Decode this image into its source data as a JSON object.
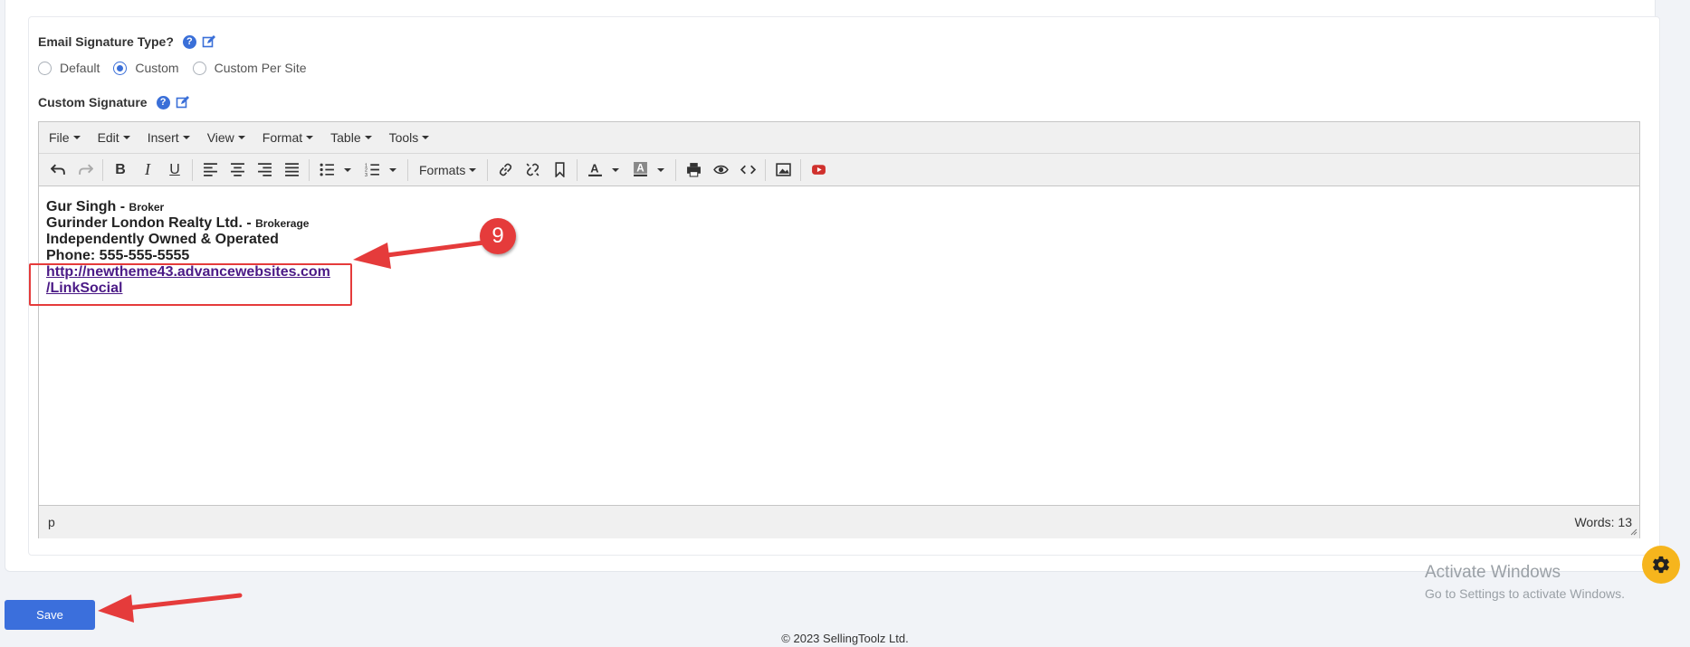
{
  "signature_type": {
    "label": "Email Signature Type?",
    "options": [
      {
        "label": "Default",
        "checked": false
      },
      {
        "label": "Custom",
        "checked": true
      },
      {
        "label": "Custom Per Site",
        "checked": false
      }
    ]
  },
  "custom_signature": {
    "label": "Custom Signature"
  },
  "editor": {
    "menus": [
      "File",
      "Edit",
      "Insert",
      "View",
      "Format",
      "Table",
      "Tools"
    ],
    "formats_label": "Formats",
    "content": {
      "line1_name": "Gur Singh - ",
      "line1_title": "Broker",
      "line2_name": "Gurinder London Realty Ltd. - ",
      "line2_title": "Brokerage",
      "line3": "Independently Owned & Operated",
      "line4": "Phone: 555-555-5555",
      "link_line1": "http://newtheme43.advancewebsites.com",
      "link_line2": "/LinkSocial"
    },
    "status_path": "p",
    "word_count": "Words: 13"
  },
  "annotation": {
    "step_number": "9",
    "color": "#e53b3b"
  },
  "save_label": "Save",
  "footer": "© 2023 SellingToolz Ltd.",
  "windows_watermark": {
    "title": "Activate Windows",
    "subtitle": "Go to Settings to activate Windows."
  },
  "colors": {
    "accent": "#3b6fdc",
    "fab": "#f6b51d",
    "link": "#4b1a86"
  }
}
